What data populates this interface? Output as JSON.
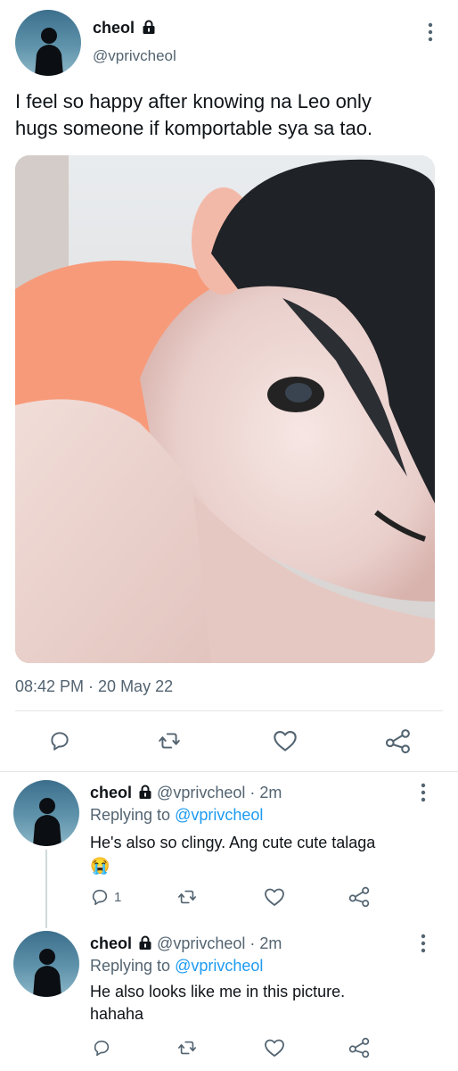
{
  "tweet": {
    "display_name": "cheol",
    "handle": "@vprivcheol",
    "text_line1": "I feel so happy after knowing na Leo only",
    "text_line2": "hugs someone if komportable sya sa tao.",
    "timestamp": "08:42 PM · 20 May 22",
    "icons": {
      "lock": "lock-icon",
      "more": "more-vertical-icon",
      "reply": "reply-icon",
      "retweet": "retweet-icon",
      "like": "heart-icon",
      "share": "share-icon"
    }
  },
  "replies": [
    {
      "display_name": "cheol",
      "handle": "@vprivcheol",
      "time": "· 2m",
      "replying_prefix": "Replying to",
      "replying_to": "@vprivcheol",
      "text_line1": "He's also so clingy. Ang cute cute talaga",
      "emoji": "😭",
      "reply_count": "1"
    },
    {
      "display_name": "cheol",
      "handle": "@vprivcheol",
      "time": "· 2m",
      "replying_prefix": "Replying to",
      "replying_to": "@vprivcheol",
      "text_line1": "He also looks like me in this picture.",
      "text_line2": "hahaha"
    }
  ],
  "colors": {
    "text": "#0f1419",
    "secondary": "#536471",
    "link": "#1d9bf0",
    "divider": "#e6e6e6"
  }
}
